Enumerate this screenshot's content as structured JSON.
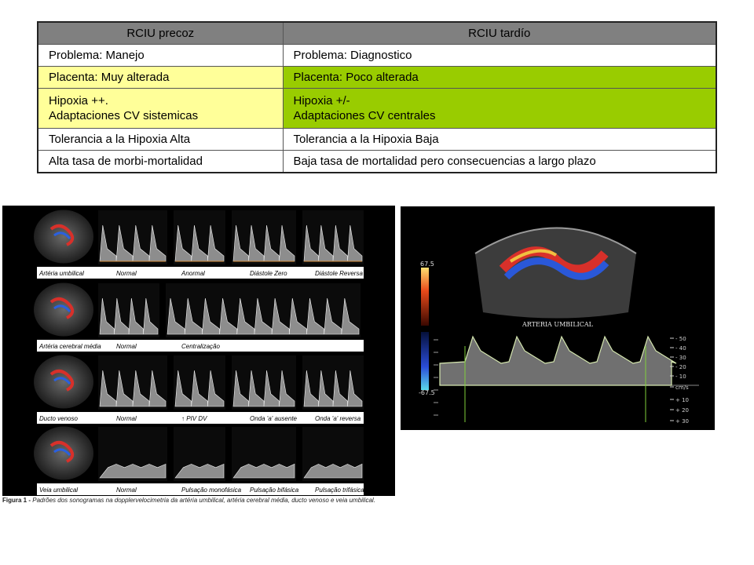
{
  "table": {
    "headers": [
      "RCIU precoz",
      "RCIU tardío"
    ],
    "rows": [
      {
        "left": "Problema: Manejo",
        "right": "Problema: Diagnostico"
      },
      {
        "left": "Placenta: Muy alterada",
        "right": "Placenta: Poco alterada"
      },
      {
        "left_lines": [
          "Hipoxia ++.",
          "Adaptaciones CV sistemicas"
        ],
        "right_lines": [
          "Hipoxia +/-",
          "Adaptaciones CV centrales"
        ]
      },
      {
        "left": "Tolerancia a la Hipoxia Alta",
        "right": "Tolerancia a la Hipoxia Baja"
      },
      {
        "left": "Alta tasa de morbi-mortalidad",
        "right": "Baja tasa de mortalidad pero consecuencias a largo plazo"
      }
    ],
    "colors": {
      "header": "#808080",
      "yellow": "#ffff99",
      "green": "#99cc00"
    }
  },
  "figure": {
    "rows": [
      {
        "vessel": "Artéria umbilical",
        "labels": [
          "Normal",
          "Anormal",
          "Diástole Zero",
          "Diástole Reversa"
        ]
      },
      {
        "vessel": "Artéria cerebral média",
        "labels": [
          "Normal",
          "Centralização"
        ]
      },
      {
        "vessel": "Ducto venoso",
        "labels": [
          "Normal",
          "↑ PIV DV",
          "Onda 'a' ausente",
          "Onda 'a' reversa"
        ]
      },
      {
        "vessel": "Veia umbilical",
        "labels": [
          "Normal",
          "Pulsação monofásica",
          "Pulsação bifásica",
          "Pulsação trifásica"
        ]
      }
    ],
    "caption_label": "Figura 1 -",
    "caption_text": "Padrões dos sonogramas na dopplervelocimetria da artéria umbilical, artéria cerebral média, ducto venoso e veia umbilical."
  },
  "doppler": {
    "title": "ARTERIA UMBILICAL",
    "scale_top": "67.5",
    "scale_bottom": "-67.5",
    "right_scale": [
      "- 50",
      "- 40",
      "- 30",
      "- 20",
      "- 10",
      "cm/s",
      "+ 10",
      "+ 20",
      "+ 30"
    ]
  }
}
